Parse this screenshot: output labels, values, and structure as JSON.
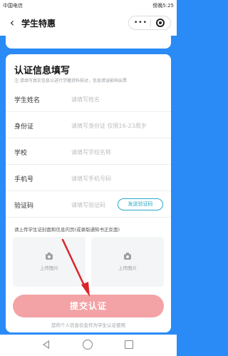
{
  "status_bar": {
    "carrier": "中国电信",
    "right_text": "傍晚5:25"
  },
  "nav": {
    "back_icon": "chevron-left-icon",
    "title": "学生特惠",
    "capsule_more": "•••",
    "capsule_close_icon": "target-icon"
  },
  "form": {
    "heading": "认证信息填写",
    "note": "注:请填写真实信息以进行学籍资料核对，信息错误影响出票",
    "fields": [
      {
        "label": "学生姓名",
        "placeholder": "请填写姓名"
      },
      {
        "label": "身份证",
        "placeholder": "请填写身份证 仅限16-23周岁"
      },
      {
        "label": "学校",
        "placeholder": "请填写学校名称"
      },
      {
        "label": "手机号",
        "placeholder": "请填写手机号码"
      },
      {
        "label": "验证码",
        "placeholder": "请填写验证码"
      }
    ],
    "send_code_label": "发送验证码",
    "upload_caption": "请上传学生证封面和信息内页(或录取通知书正反面)",
    "upload_front_label": "上传图片",
    "upload_back_label": "上传图片",
    "submit_label": "提交认证",
    "footer_note": "您的个人信息仅会作为学生认证使用"
  },
  "colors": {
    "page_background": "#2a8bf6",
    "submit_button": "#f3a3a6",
    "send_code_accent": "#27a9c6",
    "annotation_arrow": "#d9262b"
  }
}
